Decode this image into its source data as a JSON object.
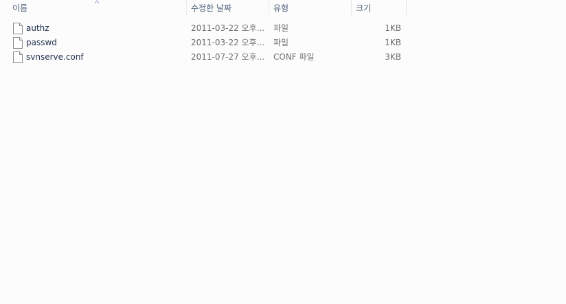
{
  "columns": {
    "name": "이름",
    "date": "수정한 날짜",
    "type": "유형",
    "size": "크기"
  },
  "files": [
    {
      "name": "authz",
      "date": "2011-03-22 오후...",
      "type": "파일",
      "size": "1KB",
      "icon": "file-icon"
    },
    {
      "name": "passwd",
      "date": "2011-03-22 오후...",
      "type": "파일",
      "size": "1KB",
      "icon": "file-icon"
    },
    {
      "name": "svnserve.conf",
      "date": "2011-07-27 오후...",
      "type": "CONF 파일",
      "size": "3KB",
      "icon": "file-icon"
    }
  ],
  "colors": {
    "header_text": "#4c607a",
    "name_text": "#1e2f4a",
    "detail_text": "#6d6d6d"
  }
}
